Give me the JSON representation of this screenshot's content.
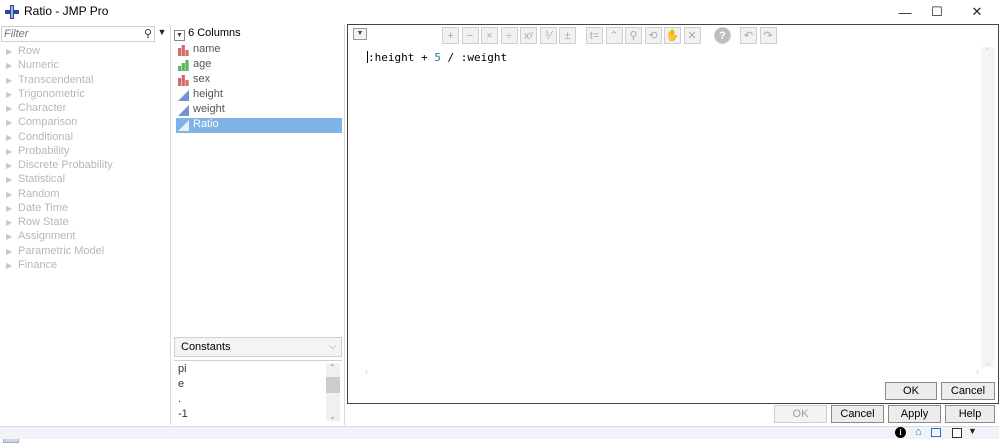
{
  "window": {
    "title": "Ratio - JMP Pro",
    "minimize": "—",
    "maximize": "☐",
    "close": "✕"
  },
  "functions": {
    "filter_placeholder": "Filter",
    "items": [
      "Row",
      "Numeric",
      "Transcendental",
      "Trigonometric",
      "Character",
      "Comparison",
      "Conditional",
      "Probability",
      "Discrete Probability",
      "Statistical",
      "Random",
      "Date Time",
      "Row State",
      "Assignment",
      "Parametric Model",
      "Finance"
    ]
  },
  "columns": {
    "header": "6 Columns",
    "items": [
      {
        "label": "name",
        "type": "nominal",
        "color": "#d46a6a"
      },
      {
        "label": "age",
        "type": "ordinal",
        "color": "#5fb35f"
      },
      {
        "label": "sex",
        "type": "nominal",
        "color": "#d46a6a"
      },
      {
        "label": "height",
        "type": "continuous",
        "color": "#5a7fc8"
      },
      {
        "label": "weight",
        "type": "continuous",
        "color": "#5a7fc8"
      },
      {
        "label": "Ratio",
        "type": "continuous",
        "color": "#5a7fc8",
        "selected": true
      }
    ]
  },
  "constants": {
    "selected": "Constants",
    "items": [
      "pi",
      "e",
      ".",
      "-1"
    ]
  },
  "toolbar": {
    "icons": [
      "plus-icon",
      "minus-icon",
      "multiply-icon",
      "divide-icon",
      "power-icon",
      "fraction-icon",
      "plus-minus-icon",
      "assign-icon",
      "up-icon",
      "local-icon",
      "swap-icon",
      "peel-icon",
      "delete-icon",
      "help-icon",
      "undo-icon",
      "redo-icon"
    ],
    "glyphs": [
      "+",
      "−",
      "×",
      "÷",
      "xʸ",
      "⅟",
      "±",
      "t=",
      "⌃",
      "⚲",
      "⟲",
      "✋",
      "✕",
      "?",
      "↶",
      "↷"
    ]
  },
  "formula": {
    "part1": ":height + ",
    "number": "5",
    "part2": " / :weight"
  },
  "editor_buttons": {
    "ok": "OK",
    "cancel": "Cancel"
  },
  "dialog_buttons": {
    "ok": "OK",
    "cancel": "Cancel",
    "apply": "Apply",
    "help": "Help"
  },
  "colors": {
    "selection": "#7fb2e5",
    "number": "#1a7fa8"
  }
}
